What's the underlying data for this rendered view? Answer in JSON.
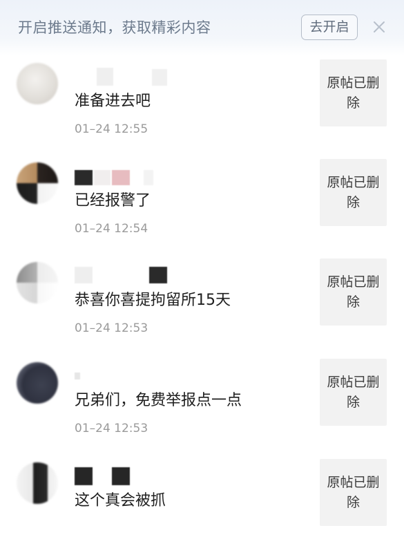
{
  "banner": {
    "text": "开启推送通知，获取精彩内容",
    "button_label": "去开启"
  },
  "comments": [
    {
      "text": "准备进去吧",
      "time": "01–24 12:55",
      "post_status_line1": "原帖已删",
      "post_status_line2": "除"
    },
    {
      "text": "已经报警了",
      "time": "01–24 12:54",
      "post_status_line1": "原帖已删",
      "post_status_line2": "除"
    },
    {
      "text": "恭喜你喜提拘留所15天",
      "time": "01–24 12:53",
      "post_status_line1": "原帖已删",
      "post_status_line2": "除"
    },
    {
      "text": "兄弟们，免费举报点一点",
      "time": "01–24 12:53",
      "post_status_line1": "原帖已删",
      "post_status_line2": "除"
    },
    {
      "text": "这个真会被抓",
      "time": "",
      "post_status_line1": "原帖已删",
      "post_status_line2": "除"
    }
  ]
}
